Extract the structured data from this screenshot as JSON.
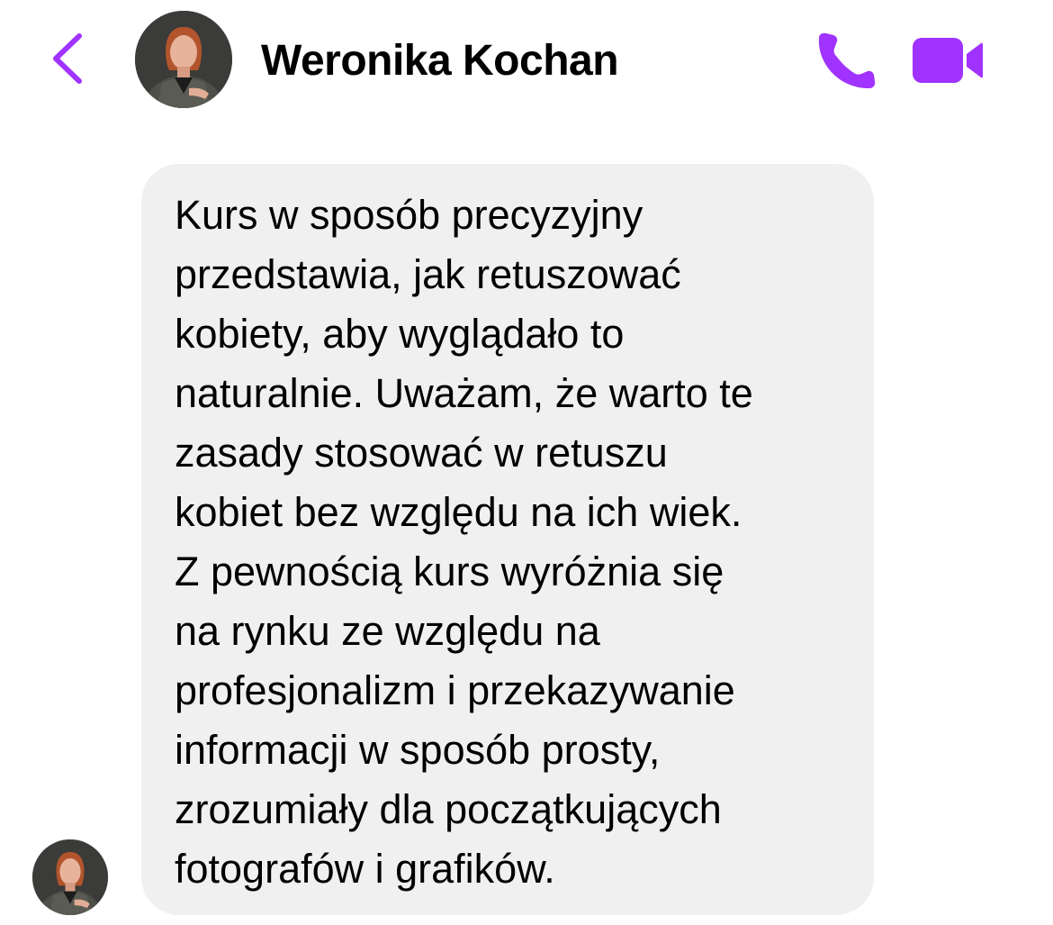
{
  "header": {
    "contact_name": "Weronika Kochan",
    "back_icon": "chevron-left-icon",
    "call_icon": "phone-icon",
    "video_icon": "video-camera-icon",
    "accent_color": "#a033ff"
  },
  "message": {
    "bubble_color": "#f0f0f0",
    "lines": [
      "Kurs w sposób precyzyjny",
      "przedstawia, jak retuszować",
      "kobiety, aby wyglądało to",
      "naturalnie. Uważam, że warto te",
      "zasady stosować w retuszu",
      "kobiet bez względu na ich wiek.",
      "Z pewnością kurs wyróżnia się",
      "na rynku ze względu na",
      "profesjonalizm i przekazywanie",
      "informacji w sposób prosty,",
      "zrozumiały dla początkujących",
      "fotografów i grafików."
    ]
  }
}
